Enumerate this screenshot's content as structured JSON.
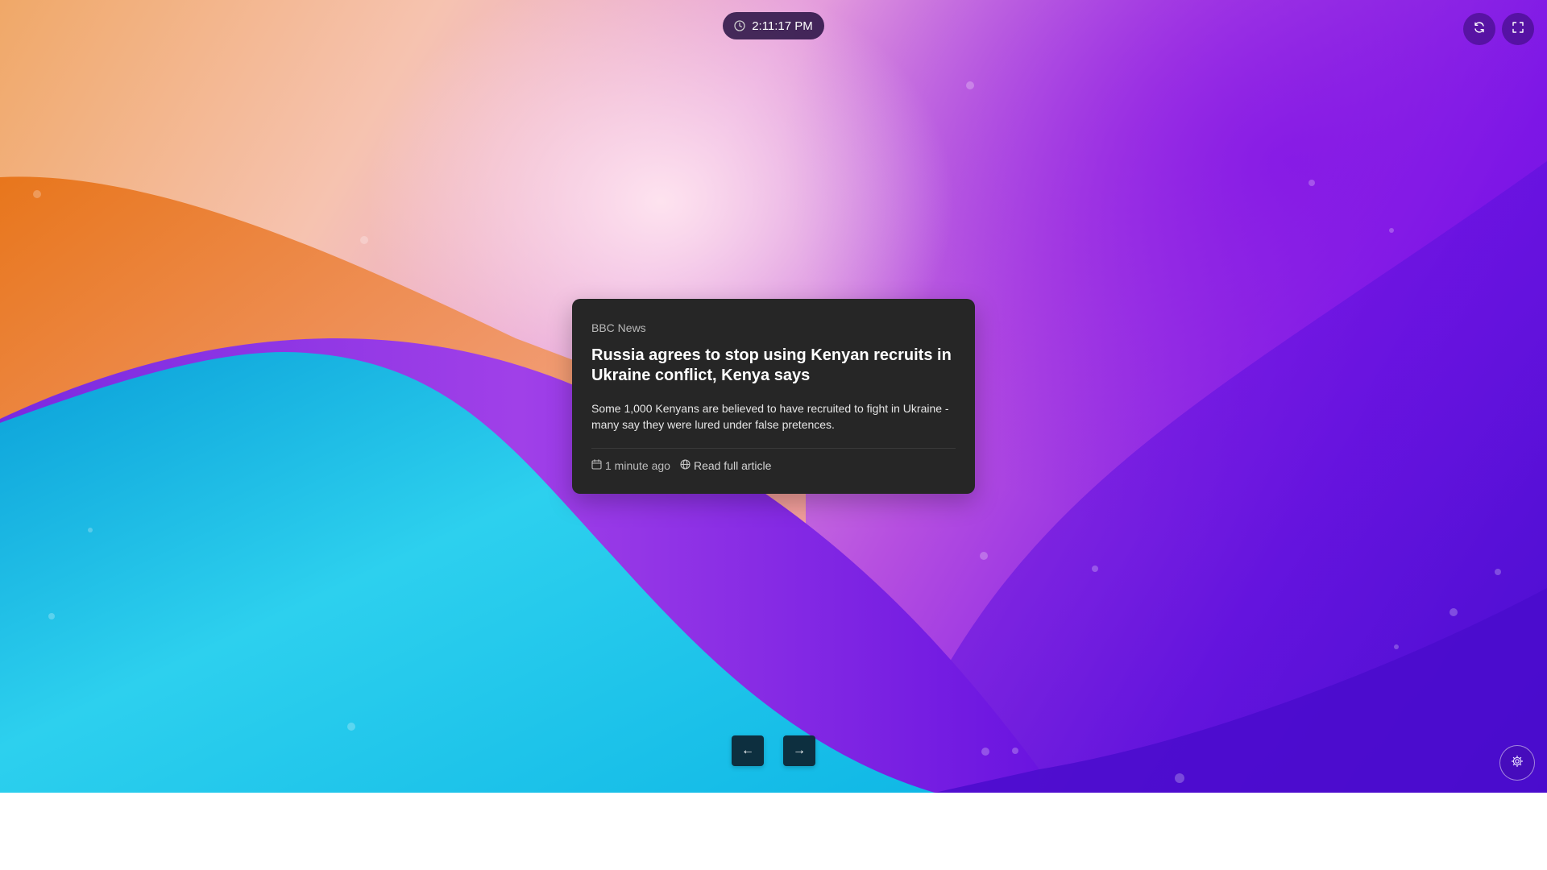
{
  "header": {
    "clock_time": "2:11:17 PM",
    "clock_icon": "clock-icon",
    "refresh_icon": "refresh-icon",
    "fullscreen_icon": "fullscreen-icon"
  },
  "article": {
    "source": "BBC News",
    "headline": "Russia agrees to stop using Kenyan recruits in Ukraine conflict, Kenya says",
    "summary": "Some 1,000 Kenyans are believed to have recruited to fight in Ukraine - many say they were lured under false pretences.",
    "time_ago": "1 minute ago",
    "read_link": "Read full article",
    "calendar_icon": "calendar-icon",
    "globe_icon": "globe-icon"
  },
  "navigation": {
    "prev_label": "←",
    "next_label": "→"
  },
  "settings": {
    "icon": "gear-icon"
  },
  "colors": {
    "card_background": "#262626",
    "nav_button": "#0d2f3f",
    "wave_cyan": "#1cc6ea",
    "wave_orange": "#f08a40",
    "wave_purple": "#8a1ee8"
  }
}
